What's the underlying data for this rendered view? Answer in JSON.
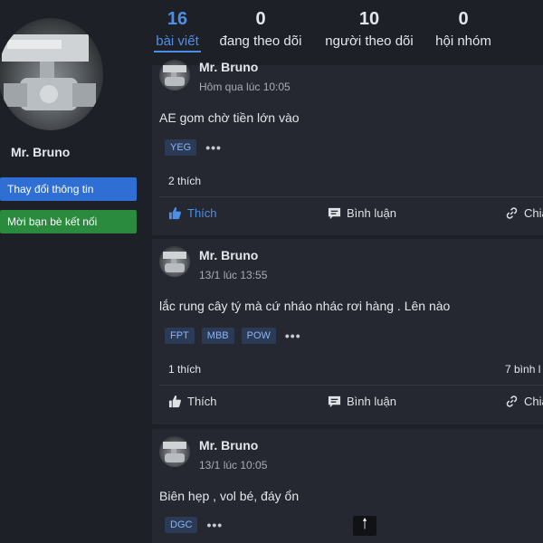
{
  "profile": {
    "name": "Mr. Bruno",
    "avatar_icon": "valve-photo",
    "edit_button": "Thay đổi thông tin",
    "invite_button": "Mời bạn bè kết nối"
  },
  "stats": [
    {
      "value": "16",
      "label": "bài viết",
      "active": true
    },
    {
      "value": "0",
      "label": "đang theo dõi"
    },
    {
      "value": "10",
      "label": "người theo dõi"
    },
    {
      "value": "0",
      "label": "hội nhóm"
    }
  ],
  "posts": [
    {
      "author": "Mr. Bruno",
      "time": "Hôm qua lúc 10:05",
      "content": "AE gom chờ tiền lớn vào",
      "tags": [
        "YEG"
      ],
      "more": "•••",
      "likes": "2 thích",
      "comments_count": "",
      "actions": {
        "like": "Thích",
        "comment": "Bình luận",
        "share": "Chia"
      }
    },
    {
      "author": "Mr. Bruno",
      "time": "13/1 lúc 13:55",
      "content": "lắc rung cây tý mà cứ nháo nhác rơi hàng . Lên nào",
      "tags": [
        "FPT",
        "MBB",
        "POW"
      ],
      "more": "•••",
      "likes": "1 thích",
      "comments_count": "7 bình l",
      "actions": {
        "like": "Thích",
        "comment": "Bình luận",
        "share": "Chia"
      }
    },
    {
      "author": "Mr. Bruno",
      "time": "13/1 lúc 10:05",
      "content": "Biên hẹp , vol bé, đáy ổn",
      "tags": [
        "DGC"
      ],
      "more": "•••"
    }
  ],
  "scroll_top_icon": "arrow-up-icon",
  "colors": {
    "background": "#1e2028",
    "card": "#252831",
    "accent": "#4c8fe8",
    "edit_btn": "#2f6fd3",
    "invite_btn": "#2a8a3e",
    "tag_bg": "#2b3a55"
  }
}
